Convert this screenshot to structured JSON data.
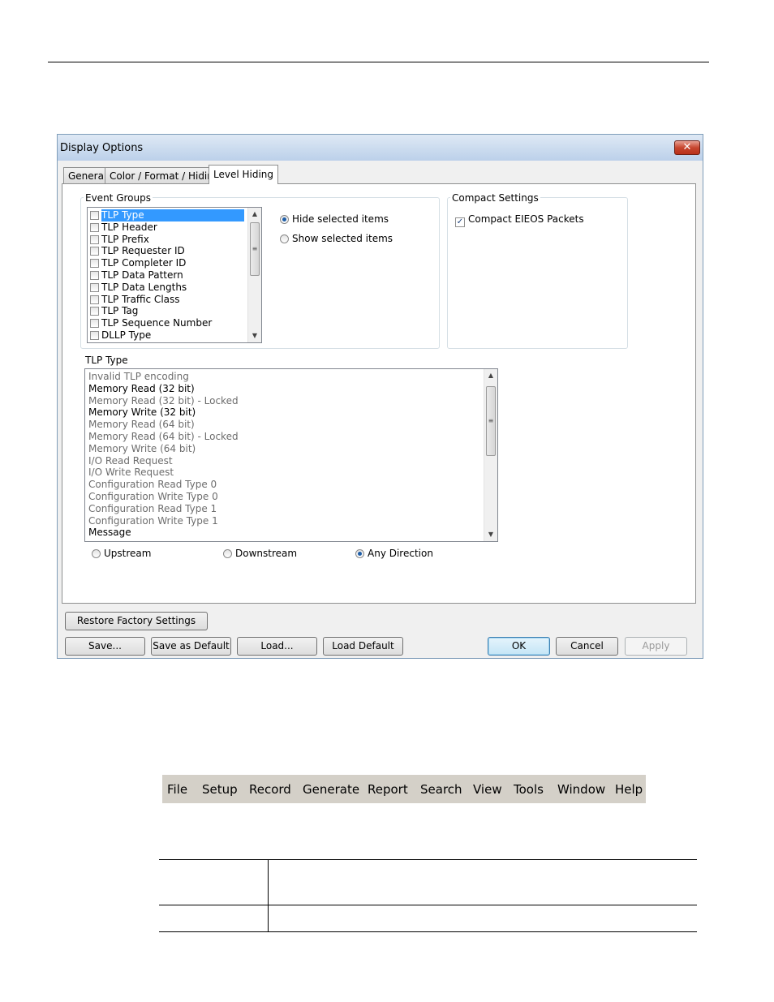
{
  "dialog": {
    "title": "Display Options",
    "close_glyph": "✕",
    "tabs": [
      "General",
      "Color / Format / Hiding",
      "Level Hiding"
    ],
    "active_tab": "Level Hiding",
    "event_groups": {
      "legend": "Event Groups",
      "items": [
        {
          "label": "TLP Type",
          "selected": true
        },
        {
          "label": "TLP Header"
        },
        {
          "label": "TLP Prefix"
        },
        {
          "label": "TLP Requester ID"
        },
        {
          "label": "TLP Completer ID"
        },
        {
          "label": "TLP Data Pattern"
        },
        {
          "label": "TLP Data Lengths"
        },
        {
          "label": "TLP Traffic Class"
        },
        {
          "label": "TLP Tag"
        },
        {
          "label": "TLP Sequence Number"
        },
        {
          "label": "DLLP Type"
        }
      ],
      "hide_option": "Hide selected items",
      "show_option": "Show selected items",
      "selected_option": "hide"
    },
    "compact_settings": {
      "legend": "Compact Settings",
      "compact_eieos_label": "Compact EIEOS Packets",
      "compact_eieos_checked": true
    },
    "tlp_type": {
      "label": "TLP Type",
      "items": [
        {
          "label": "Invalid TLP encoding",
          "enabled": false
        },
        {
          "label": "Memory Read (32 bit)",
          "enabled": true
        },
        {
          "label": "Memory Read (32 bit) - Locked",
          "enabled": false
        },
        {
          "label": "Memory Write (32 bit)",
          "enabled": true
        },
        {
          "label": "Memory Read (64 bit)",
          "enabled": false
        },
        {
          "label": "Memory Read (64 bit) - Locked",
          "enabled": false
        },
        {
          "label": "Memory Write (64 bit)",
          "enabled": false
        },
        {
          "label": "I/O Read Request",
          "enabled": false
        },
        {
          "label": "I/O Write Request",
          "enabled": false
        },
        {
          "label": "Configuration Read Type 0",
          "enabled": false
        },
        {
          "label": "Configuration Write Type 0",
          "enabled": false
        },
        {
          "label": "Configuration Read Type 1",
          "enabled": false
        },
        {
          "label": "Configuration Write Type 1",
          "enabled": false
        },
        {
          "label": "Message",
          "enabled": true
        }
      ]
    },
    "direction": {
      "upstream": "Upstream",
      "downstream": "Downstream",
      "any": "Any Direction",
      "selected": "any"
    },
    "buttons": {
      "restore": "Restore Factory Settings",
      "save": "Save...",
      "save_default": "Save as Default",
      "load": "Load...",
      "load_default": "Load Default",
      "ok": "OK",
      "cancel": "Cancel",
      "apply": "Apply"
    }
  },
  "menubar": {
    "items": [
      "File",
      "Setup",
      "Record",
      "Generate",
      "Report",
      "Search",
      "View",
      "Tools",
      "Window",
      "Help"
    ]
  }
}
